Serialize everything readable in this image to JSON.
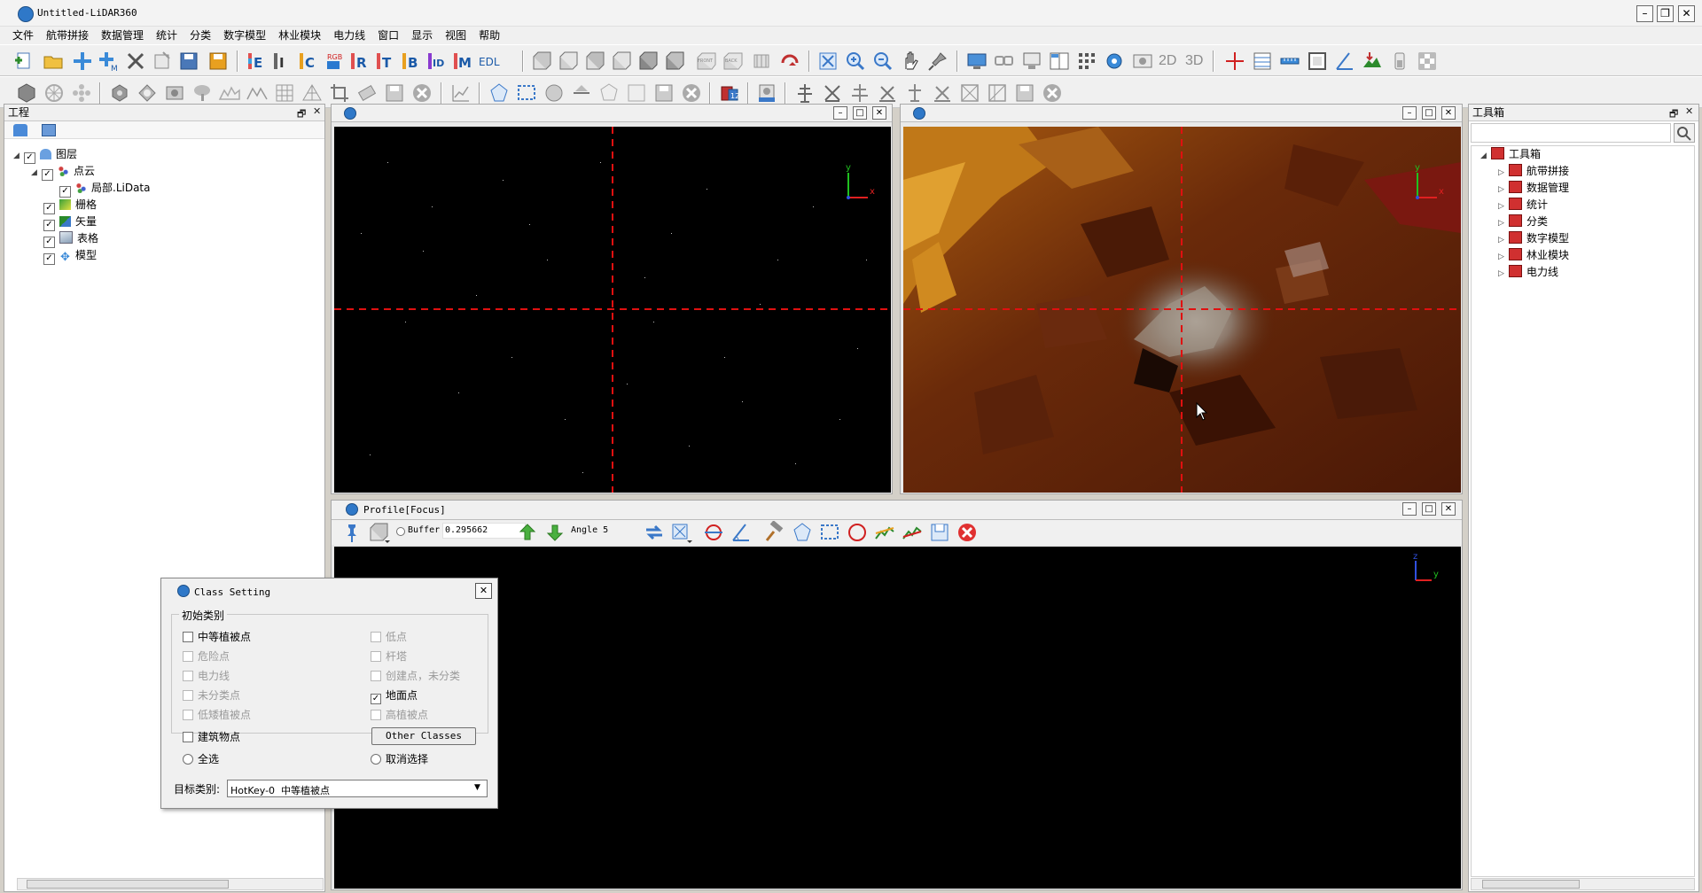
{
  "window": {
    "title": "Untitled-LiDAR360"
  },
  "menu": [
    "文件",
    "航带拼接",
    "数据管理",
    "统计",
    "分类",
    "数字模型",
    "林业模块",
    "电力线",
    "窗口",
    "显示",
    "视图",
    "帮助"
  ],
  "toolbar1": {
    "labels": {
      "e": "E",
      "i": "I",
      "c": "C",
      "rgb": "RGB",
      "r": "R",
      "t": "T",
      "b": "B",
      "id": "ID",
      "m": "M",
      "edl": "EDL",
      "front": "FRONT",
      "back": "BACK",
      "view2d": "2D",
      "view3d": "3D"
    }
  },
  "project_panel": {
    "title": "工程",
    "tree": {
      "layers": "图层",
      "pointcloud": "点云",
      "file": "局部.LiData",
      "raster": "栅格",
      "vector": "矢量",
      "table": "表格",
      "model": "模型"
    }
  },
  "toolbox_panel": {
    "title": "工具箱",
    "root": "工具箱",
    "items": [
      "航带拼接",
      "数据管理",
      "统计",
      "分类",
      "数字模型",
      "林业模块",
      "电力线"
    ]
  },
  "profile_panel": {
    "title": "Profile[Focus]",
    "buffer_label": "Buffer",
    "buffer_value": "0.295662",
    "angle_label": "Angle",
    "angle_value": "5"
  },
  "axes": {
    "x": "x",
    "y": "y",
    "z": "z"
  },
  "class_dialog": {
    "title": "Class Setting",
    "group_label": "初始类别",
    "left_options": [
      {
        "label": "中等植被点",
        "checked": false,
        "enabled": true
      },
      {
        "label": "危险点",
        "checked": false,
        "enabled": false
      },
      {
        "label": "电力线",
        "checked": false,
        "enabled": false
      },
      {
        "label": "未分类点",
        "checked": false,
        "enabled": false
      },
      {
        "label": "低矮植被点",
        "checked": false,
        "enabled": false
      },
      {
        "label": "建筑物点",
        "checked": false,
        "enabled": true
      }
    ],
    "right_options": [
      {
        "label": "低点",
        "checked": false,
        "enabled": false
      },
      {
        "label": "杆塔",
        "checked": false,
        "enabled": false
      },
      {
        "label": "创建点，未分类",
        "checked": false,
        "enabled": false
      },
      {
        "label": "地面点",
        "checked": true,
        "enabled": true
      },
      {
        "label": "高植被点",
        "checked": false,
        "enabled": false
      }
    ],
    "other_classes_button": "Other Classes",
    "select_all": "全选",
    "deselect": "取消选择",
    "target_label": "目标类别:",
    "target_value": "HotKey-0  中等植被点"
  }
}
